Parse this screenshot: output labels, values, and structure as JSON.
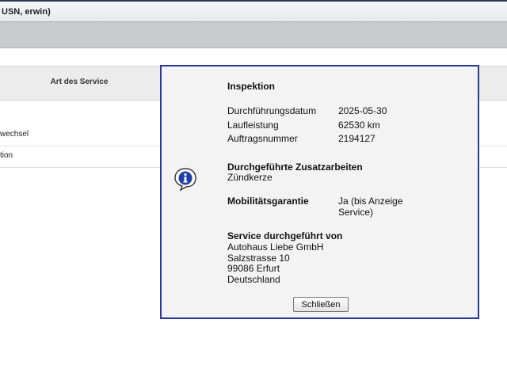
{
  "window": {
    "title": "USN, erwin)"
  },
  "table": {
    "header": "Art des Service",
    "rows": [
      {
        "text": "wechsel"
      },
      {
        "text": "tion"
      }
    ]
  },
  "dialog": {
    "title": "Inspektion",
    "details": [
      {
        "label": "Durchführungsdatum",
        "value": "2025-05-30"
      },
      {
        "label": "Laufleistung",
        "value": "62530 km"
      },
      {
        "label": "Auftragsnummer",
        "value": "2194127"
      }
    ],
    "extra_work_heading": "Durchgeführte Zusatzarbeiten",
    "extra_work_value": "Zündkerze",
    "mobility_label": "Mobilitätsgarantie",
    "mobility_value_line1": "Ja (bis Anzeige",
    "mobility_value_line2": "Service)",
    "service_heading": "Service durchgeführt von",
    "service_lines": [
      "Autohaus Liebe GmbH",
      "Salzstrasse 10",
      "99086 Erfurt",
      "Deutschland"
    ],
    "close_label": "Schließen",
    "icon": "info-icon"
  },
  "colors": {
    "dialog_border": "#2b3a9a",
    "window_border": "#2c3e55"
  }
}
